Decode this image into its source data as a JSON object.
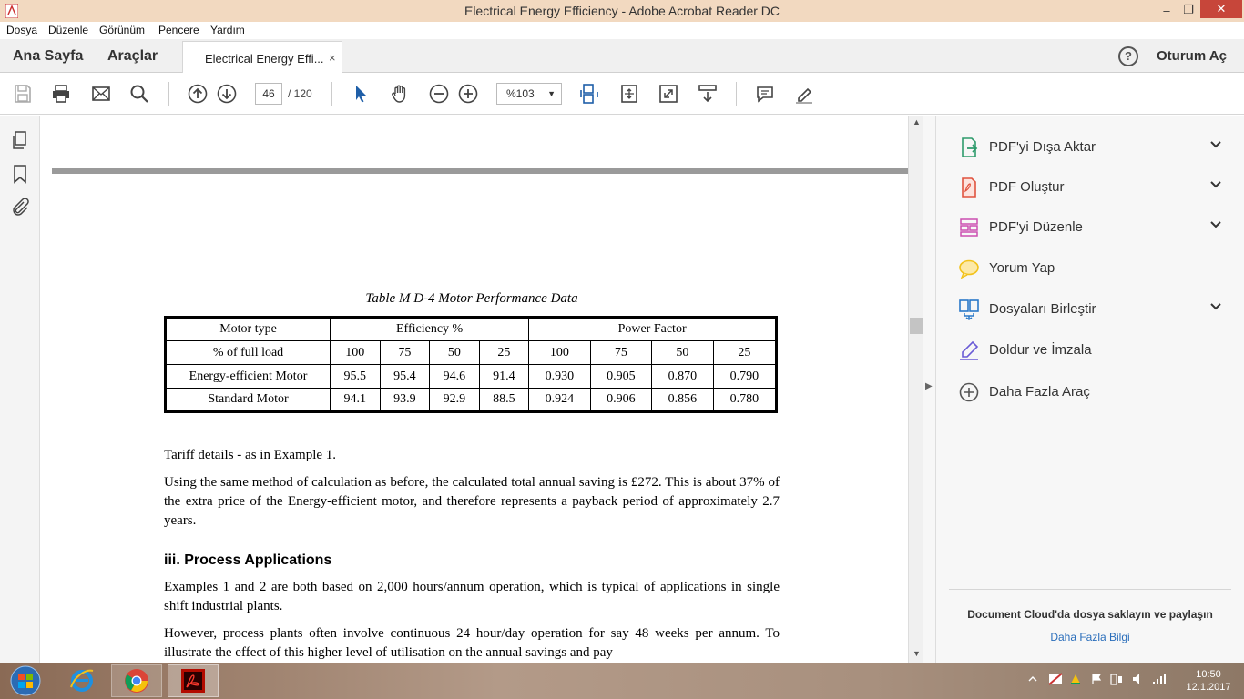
{
  "window": {
    "title": "Electrical Energy Efficiency - Adobe Acrobat Reader DC",
    "minimize": "–",
    "maximize": "❐",
    "close": "✕"
  },
  "menu": [
    "Dosya",
    "Düzenle",
    "Görünüm",
    "Pencere",
    "Yardım"
  ],
  "tabs": {
    "home": "Ana Sayfa",
    "tools": "Araçlar",
    "document": "Electrical Energy Effi...",
    "close": "×",
    "help": "?",
    "signin": "Oturum Aç"
  },
  "toolbar": {
    "page_current": "46",
    "page_total": "/ 120",
    "zoom": "%103"
  },
  "document": {
    "table_title": "Table M   D-4   Motor Performance Data",
    "table": {
      "header1": [
        "Motor type",
        "Efficiency %",
        "Power Factor"
      ],
      "header2": [
        "% of full load",
        "100",
        "75",
        "50",
        "25",
        "100",
        "75",
        "50",
        "25"
      ],
      "rows": [
        [
          "Energy-efficient Motor",
          "95.5",
          "95.4",
          "94.6",
          "91.4",
          "0.930",
          "0.905",
          "0.870",
          "0.790"
        ],
        [
          "Standard Motor",
          "94.1",
          "93.9",
          "92.9",
          "88.5",
          "0.924",
          "0.906",
          "0.856",
          "0.780"
        ]
      ]
    },
    "p1": "Tariff details - as in Example 1.",
    "p2": "Using the same method of calculation as before, the calculated total annual saving is £272.  This is about 37% of the extra price of the Energy-efficient motor, and therefore represents a payback period of approximately 2.7 years.",
    "heading": "iii.  Process Applications",
    "p3": "Examples 1 and 2 are both based on 2,000 hours/annum operation, which is typical of applications in single shift industrial plants.",
    "p4": "However, process plants often involve continuous 24 hour/day operation for say 48 weeks per annum.  To illustrate the effect of this higher level of utilisation on the annual savings and pay"
  },
  "right_panel": {
    "tools": [
      {
        "label": "PDF'yi Dışa Aktar",
        "icon": "export-pdf-icon",
        "color": "#2e9b6c"
      },
      {
        "label": "PDF Oluştur",
        "icon": "create-pdf-icon",
        "color": "#e0533f"
      },
      {
        "label": "PDF'yi Düzenle",
        "icon": "edit-pdf-icon",
        "color": "#cc4fb0"
      },
      {
        "label": "Yorum Yap",
        "icon": "comment-icon",
        "color": "#f2c21b"
      },
      {
        "label": "Dosyaları Birleştir",
        "icon": "combine-files-icon",
        "color": "#2a78c8"
      },
      {
        "label": "Doldur ve İmzala",
        "icon": "fill-sign-icon",
        "color": "#6a5bd6"
      },
      {
        "label": "Daha Fazla Araç",
        "icon": "more-tools-icon",
        "color": "#555555"
      }
    ],
    "cloud_message": "Document Cloud'da dosya saklayın ve paylaşın",
    "cloud_link": "Daha Fazla Bilgi"
  },
  "taskbar": {
    "time": "10:50",
    "date": "12.1.2017"
  }
}
